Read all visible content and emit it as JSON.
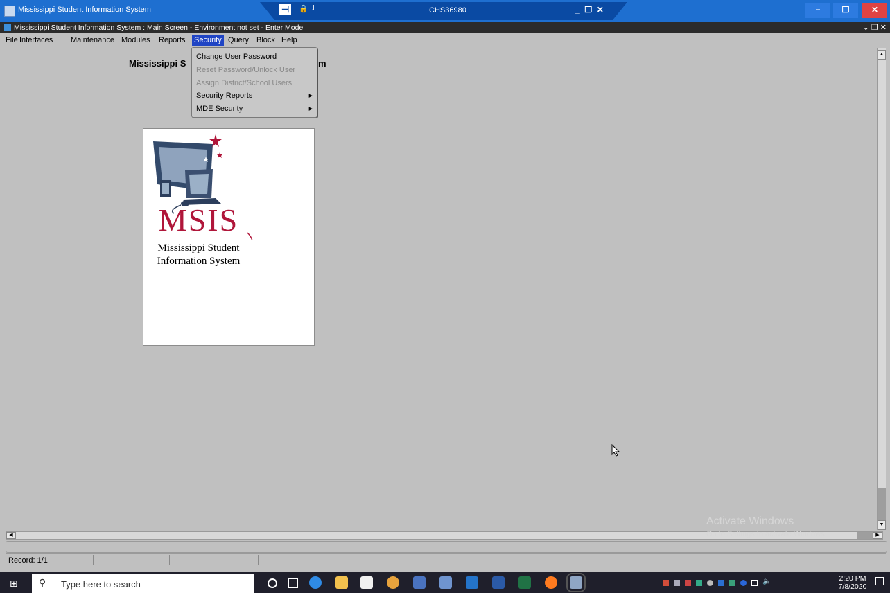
{
  "outer_window": {
    "title": "Mississippi Student Information System",
    "rdp": {
      "pin": "⊣",
      "host": "CHS36980"
    }
  },
  "inner_window": {
    "title": "Mississippi Student Information System : Main Screen  -  Environment not set  -  Enter Mode"
  },
  "menu": {
    "items": [
      "File",
      "Interfaces",
      "Maintenance",
      "Modules",
      "Reports",
      "Security",
      "Query",
      "Block",
      "Help"
    ],
    "active": "Security"
  },
  "security_menu": {
    "items": [
      {
        "label": "Change User Password",
        "enabled": true,
        "submenu": false
      },
      {
        "label": "Reset Password/Unlock User",
        "enabled": false,
        "submenu": false
      },
      {
        "label": "Assign District/School Users",
        "enabled": false,
        "submenu": false
      },
      {
        "label": "Security Reports",
        "enabled": true,
        "submenu": true
      },
      {
        "label": "MDE Security",
        "enabled": true,
        "submenu": true
      }
    ]
  },
  "main": {
    "form_title_visible_start": "Mississippi S",
    "form_title_visible_end": "m",
    "logo": {
      "acronym": "MSIS",
      "line1": "Mississippi Student",
      "line2": "Information System"
    }
  },
  "activation_notice": {
    "title": "Activate Windows",
    "subtitle": "Go to Settings to activate Windows."
  },
  "status": {
    "record": "Record: 1/1"
  },
  "taskbar": {
    "search_placeholder": "Type here to search",
    "time": "2:20 PM",
    "date": "7/8/2020",
    "icons": [
      "cortana-icon",
      "task-view-icon",
      "edge-icon",
      "file-explorer-icon",
      "store-icon",
      "chrome-icon",
      "maps-icon",
      "photos-icon",
      "outlook-icon",
      "word-icon",
      "excel-icon",
      "firefox-icon",
      "java-app-icon"
    ]
  },
  "colors": {
    "outer_titlebar": "#1e6fd0",
    "menu_highlight": "#1f44c4",
    "background": "#c0c0c0",
    "logo_red": "#b0163a"
  }
}
